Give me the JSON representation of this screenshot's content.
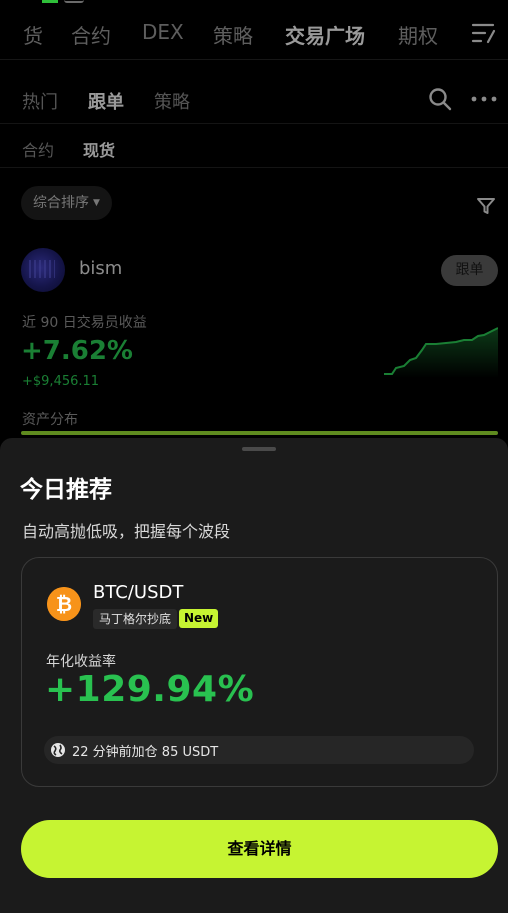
{
  "top_nav": {
    "items": [
      "货",
      "合约",
      "DEX",
      "策略",
      "交易广场",
      "期权"
    ],
    "active": "交易广场"
  },
  "sub_tabs": {
    "items": [
      "热门",
      "跟单",
      "策略"
    ],
    "active": "跟单"
  },
  "type_tabs": {
    "items": [
      "合约",
      "现货"
    ],
    "active": "现货"
  },
  "sort": {
    "label": "综合排序"
  },
  "trader": {
    "name": "bism",
    "follow_label": "跟单",
    "pnl_label": "近 90 日交易员收益",
    "pnl_percent": "+7.62%",
    "pnl_amount": "+$9,456.11",
    "allocation_label": "资产分布"
  },
  "sheet": {
    "title": "今日推荐",
    "subtitle": "自动高抛低吸，把握每个波段",
    "card": {
      "pair": "BTC/USDT",
      "strategy": "马丁格尔抄底",
      "badge": "New",
      "apy_label": "年化收益率",
      "apy_value": "+129.94%",
      "activity": "22 分钟前加仓 85 USDT"
    },
    "cta_label": "查看详情"
  },
  "colors": {
    "accent": "#c6f432",
    "positive": "#29c150",
    "bitcoin": "#f7931a",
    "sheet_bg": "#1b1b1b"
  },
  "icons": [
    "search-icon",
    "more-icon",
    "menu-icon",
    "filter-icon",
    "bitcoin-icon",
    "globe-icon"
  ]
}
